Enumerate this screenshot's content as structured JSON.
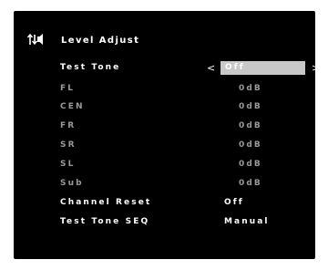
{
  "header": {
    "title": "Level Adjust",
    "icon": "level-adjust-icon"
  },
  "selector_arrows": {
    "left": "<",
    "right": ">"
  },
  "colors": {
    "background": "#000000",
    "text_active": "#ffffff",
    "text_inactive": "#9a9a9a",
    "selection_highlight": "#c8c8c8"
  },
  "menu": {
    "items": [
      {
        "label": "Test Tone",
        "value": "Off"
      },
      {
        "label": "FL",
        "value": "0dB"
      },
      {
        "label": "CEN",
        "value": "0dB"
      },
      {
        "label": "FR",
        "value": "0dB"
      },
      {
        "label": "SR",
        "value": "0dB"
      },
      {
        "label": "SL",
        "value": "0dB"
      },
      {
        "label": "Sub",
        "value": "0dB"
      },
      {
        "label": "Channel Reset",
        "value": "Off"
      },
      {
        "label": "Test Tone SEQ",
        "value": "Manual"
      }
    ]
  }
}
